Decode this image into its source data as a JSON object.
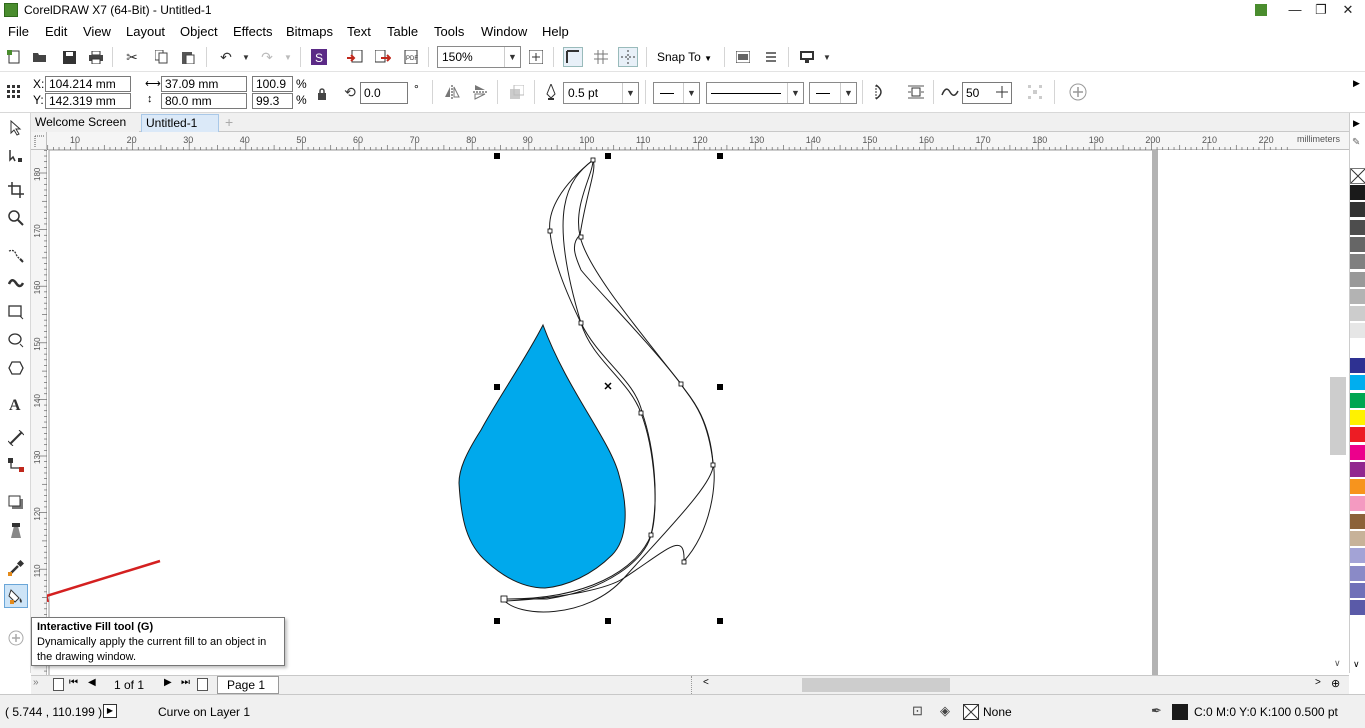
{
  "window": {
    "title": "CorelDRAW X7 (64-Bit) - Untitled-1",
    "minimize": "—",
    "maximize": "❐",
    "close": "✕"
  },
  "menu": [
    "File",
    "Edit",
    "View",
    "Layout",
    "Object",
    "Effects",
    "Bitmaps",
    "Text",
    "Table",
    "Tools",
    "Window",
    "Help"
  ],
  "toolbar": {
    "zoom": "150%",
    "snap_to": "Snap To"
  },
  "properties": {
    "x_label": "X:",
    "x": "104.214 mm",
    "y_label": "Y:",
    "y": "142.319 mm",
    "width": "37.09 mm",
    "height": "80.0 mm",
    "scale_w": "100.9",
    "scale_h": "99.3",
    "percent": "%",
    "rotation": "0.0",
    "degree": "°",
    "outline_width": "0.5 pt",
    "smoothing": "50"
  },
  "tabs": {
    "welcome": "Welcome Screen",
    "doc": "Untitled-1",
    "add": "+"
  },
  "ruler": {
    "unit": "millimeters",
    "h_ticks": [
      "10",
      "20",
      "30",
      "40",
      "50",
      "60",
      "70",
      "80",
      "90",
      "100",
      "110",
      "120",
      "130",
      "140",
      "150",
      "160",
      "170",
      "180",
      "190",
      "200",
      "210",
      "220"
    ],
    "v_ticks": [
      "180",
      "170",
      "160",
      "150",
      "140",
      "130",
      "120",
      "110"
    ]
  },
  "pagenav": {
    "page_count": "1 of 1",
    "page_tab": "Page 1"
  },
  "status": {
    "coords": "( 5.744 , 110.199 )",
    "object": "Curve on Layer 1",
    "fill": "None",
    "outline": "C:0 M:0 Y:0 K:100  0.500 pt"
  },
  "tooltip": {
    "title": "Interactive Fill tool (G)",
    "body": "Dynamically apply the current fill to an object in the drawing window."
  },
  "colors": {
    "drop_fill": "#00a9ec",
    "arrow": "#d42020",
    "palette": [
      "#1a1a1a",
      "#333333",
      "#4d4d4d",
      "#666666",
      "#808080",
      "#999999",
      "#b3b3b3",
      "#cccccc",
      "#e6e6e6",
      "#ffffff",
      "#2e3192",
      "#00aeef",
      "#00a651",
      "#fff200",
      "#ed1c24",
      "#ec008c",
      "#92278f",
      "#f7941d",
      "#f49ac1",
      "#8c6239",
      "#c7b299",
      "#a3a3d6",
      "#8a8ac7",
      "#7070b8",
      "#5a5aa8"
    ]
  }
}
